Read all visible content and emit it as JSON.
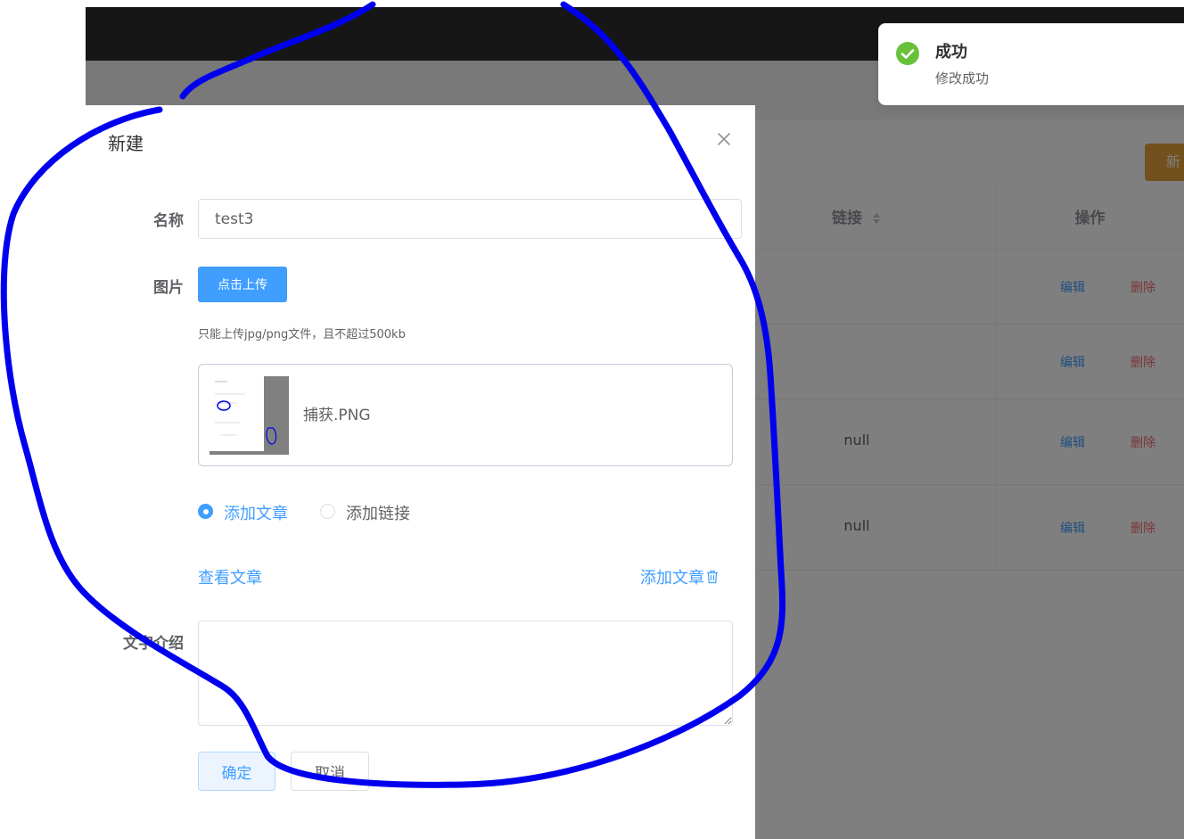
{
  "toast": {
    "title": "成功",
    "message": "修改成功",
    "icon": "check-circle-icon",
    "color": "#67c23a"
  },
  "toolbar": {
    "new_button_label": "新"
  },
  "table": {
    "headers": [
      "链接",
      "操作"
    ],
    "rows": [
      {
        "link": "",
        "edit": "编辑",
        "delete": "删除"
      },
      {
        "link": "",
        "edit": "编辑",
        "delete": "删除"
      },
      {
        "link": "null",
        "edit": "编辑",
        "delete": "删除"
      },
      {
        "link": "null",
        "edit": "编辑",
        "delete": "删除"
      }
    ]
  },
  "dialog": {
    "title": "新建",
    "close_icon": "close-icon",
    "name_label": "名称",
    "name_value": "test3",
    "image_label": "图片",
    "upload_button": "点击上传",
    "upload_tip": "只能上传jpg/png文件，且不超过500kb",
    "file_name": "捕获.PNG",
    "radio_options": [
      {
        "label": "添加文章",
        "checked": true
      },
      {
        "label": "添加链接",
        "checked": false
      }
    ],
    "view_article_link": "查看文章",
    "add_article_link": "添加文章",
    "intro_label": "文字介绍",
    "intro_value": "",
    "confirm_button": "确定",
    "cancel_button": "取消"
  },
  "colors": {
    "primary": "#409eff",
    "danger": "#f56c6c",
    "warning": "#e6a23c",
    "annotation": "#0000ee"
  }
}
